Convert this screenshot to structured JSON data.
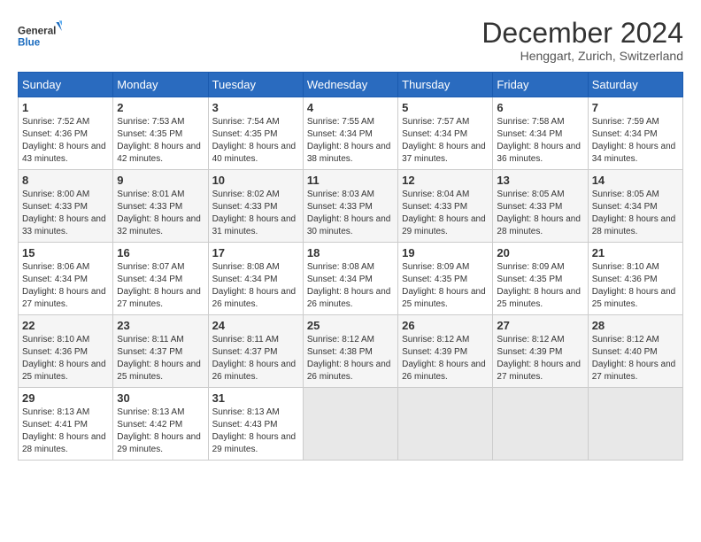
{
  "logo": {
    "line1": "General",
    "line2": "Blue"
  },
  "title": "December 2024",
  "subtitle": "Henggart, Zurich, Switzerland",
  "days_header": [
    "Sunday",
    "Monday",
    "Tuesday",
    "Wednesday",
    "Thursday",
    "Friday",
    "Saturday"
  ],
  "weeks": [
    [
      {
        "day": "1",
        "sunrise": "7:52 AM",
        "sunset": "4:36 PM",
        "daylight": "8 hours and 43 minutes."
      },
      {
        "day": "2",
        "sunrise": "7:53 AM",
        "sunset": "4:35 PM",
        "daylight": "8 hours and 42 minutes."
      },
      {
        "day": "3",
        "sunrise": "7:54 AM",
        "sunset": "4:35 PM",
        "daylight": "8 hours and 40 minutes."
      },
      {
        "day": "4",
        "sunrise": "7:55 AM",
        "sunset": "4:34 PM",
        "daylight": "8 hours and 38 minutes."
      },
      {
        "day": "5",
        "sunrise": "7:57 AM",
        "sunset": "4:34 PM",
        "daylight": "8 hours and 37 minutes."
      },
      {
        "day": "6",
        "sunrise": "7:58 AM",
        "sunset": "4:34 PM",
        "daylight": "8 hours and 36 minutes."
      },
      {
        "day": "7",
        "sunrise": "7:59 AM",
        "sunset": "4:34 PM",
        "daylight": "8 hours and 34 minutes."
      }
    ],
    [
      {
        "day": "8",
        "sunrise": "8:00 AM",
        "sunset": "4:33 PM",
        "daylight": "8 hours and 33 minutes."
      },
      {
        "day": "9",
        "sunrise": "8:01 AM",
        "sunset": "4:33 PM",
        "daylight": "8 hours and 32 minutes."
      },
      {
        "day": "10",
        "sunrise": "8:02 AM",
        "sunset": "4:33 PM",
        "daylight": "8 hours and 31 minutes."
      },
      {
        "day": "11",
        "sunrise": "8:03 AM",
        "sunset": "4:33 PM",
        "daylight": "8 hours and 30 minutes."
      },
      {
        "day": "12",
        "sunrise": "8:04 AM",
        "sunset": "4:33 PM",
        "daylight": "8 hours and 29 minutes."
      },
      {
        "day": "13",
        "sunrise": "8:05 AM",
        "sunset": "4:33 PM",
        "daylight": "8 hours and 28 minutes."
      },
      {
        "day": "14",
        "sunrise": "8:05 AM",
        "sunset": "4:34 PM",
        "daylight": "8 hours and 28 minutes."
      }
    ],
    [
      {
        "day": "15",
        "sunrise": "8:06 AM",
        "sunset": "4:34 PM",
        "daylight": "8 hours and 27 minutes."
      },
      {
        "day": "16",
        "sunrise": "8:07 AM",
        "sunset": "4:34 PM",
        "daylight": "8 hours and 27 minutes."
      },
      {
        "day": "17",
        "sunrise": "8:08 AM",
        "sunset": "4:34 PM",
        "daylight": "8 hours and 26 minutes."
      },
      {
        "day": "18",
        "sunrise": "8:08 AM",
        "sunset": "4:34 PM",
        "daylight": "8 hours and 26 minutes."
      },
      {
        "day": "19",
        "sunrise": "8:09 AM",
        "sunset": "4:35 PM",
        "daylight": "8 hours and 25 minutes."
      },
      {
        "day": "20",
        "sunrise": "8:09 AM",
        "sunset": "4:35 PM",
        "daylight": "8 hours and 25 minutes."
      },
      {
        "day": "21",
        "sunrise": "8:10 AM",
        "sunset": "4:36 PM",
        "daylight": "8 hours and 25 minutes."
      }
    ],
    [
      {
        "day": "22",
        "sunrise": "8:10 AM",
        "sunset": "4:36 PM",
        "daylight": "8 hours and 25 minutes."
      },
      {
        "day": "23",
        "sunrise": "8:11 AM",
        "sunset": "4:37 PM",
        "daylight": "8 hours and 25 minutes."
      },
      {
        "day": "24",
        "sunrise": "8:11 AM",
        "sunset": "4:37 PM",
        "daylight": "8 hours and 26 minutes."
      },
      {
        "day": "25",
        "sunrise": "8:12 AM",
        "sunset": "4:38 PM",
        "daylight": "8 hours and 26 minutes."
      },
      {
        "day": "26",
        "sunrise": "8:12 AM",
        "sunset": "4:39 PM",
        "daylight": "8 hours and 26 minutes."
      },
      {
        "day": "27",
        "sunrise": "8:12 AM",
        "sunset": "4:39 PM",
        "daylight": "8 hours and 27 minutes."
      },
      {
        "day": "28",
        "sunrise": "8:12 AM",
        "sunset": "4:40 PM",
        "daylight": "8 hours and 27 minutes."
      }
    ],
    [
      {
        "day": "29",
        "sunrise": "8:13 AM",
        "sunset": "4:41 PM",
        "daylight": "8 hours and 28 minutes."
      },
      {
        "day": "30",
        "sunrise": "8:13 AM",
        "sunset": "4:42 PM",
        "daylight": "8 hours and 29 minutes."
      },
      {
        "day": "31",
        "sunrise": "8:13 AM",
        "sunset": "4:43 PM",
        "daylight": "8 hours and 29 minutes."
      },
      null,
      null,
      null,
      null
    ]
  ],
  "labels": {
    "sunrise": "Sunrise:",
    "sunset": "Sunset:",
    "daylight": "Daylight:"
  }
}
